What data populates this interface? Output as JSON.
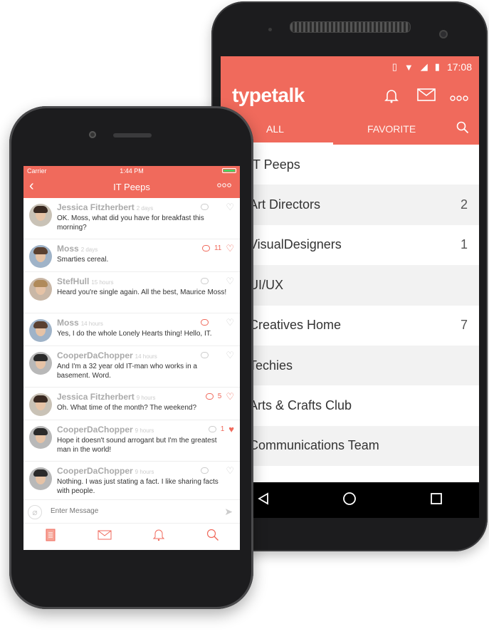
{
  "android": {
    "status_time": "17:08",
    "logo": "typetalk",
    "toolbar_icons": [
      "bell-icon",
      "mail-icon",
      "more-icon"
    ],
    "tabs": [
      {
        "label": "ALL"
      },
      {
        "label": "FAVORITE"
      }
    ],
    "topics": [
      {
        "name": "IT Peeps",
        "count": ""
      },
      {
        "name": "Art Directors",
        "count": "2"
      },
      {
        "name": "VisualDesigners",
        "count": "1"
      },
      {
        "name": "UI/UX",
        "count": ""
      },
      {
        "name": "Creatives Home",
        "count": "7"
      },
      {
        "name": "Techies",
        "count": ""
      },
      {
        "name": "Arts & Crafts Club",
        "count": ""
      },
      {
        "name": "Communications Team",
        "count": ""
      }
    ]
  },
  "ios": {
    "carrier": "Carrier",
    "time": "1:44 PM",
    "title": "IT Peeps",
    "input_placeholder": "Enter Message",
    "messages": [
      {
        "user": "Jessica Fitzherbert",
        "when": "2 days",
        "text": "OK. Moss, what did you have for breakfast this morning?",
        "replies": "",
        "likes": ""
      },
      {
        "user": "Moss",
        "when": "2 days",
        "text": "Smarties cereal.",
        "replies": "11",
        "likes": ""
      },
      {
        "user": "StefHull",
        "when": "15 hours",
        "text": "Heard you're single again. All the best, Maurice Moss!",
        "replies": "",
        "likes": ""
      },
      {
        "user": "Moss",
        "when": "14 hours",
        "text": "Yes, I do the whole Lonely Hearts thing! Hello, IT.",
        "replies": "",
        "likes": ""
      },
      {
        "user": "CooperDaChopper",
        "when": "14 hours",
        "text": "And I'm a 32 year old IT-man who works in a basement. Word.",
        "replies": "",
        "likes": ""
      },
      {
        "user": "Jessica Fitzherbert",
        "when": "9 hours",
        "text": "Oh. What time of the month? The weekend?",
        "replies": "",
        "likes": "5"
      },
      {
        "user": "CooperDaChopper",
        "when": "9 hours",
        "text": "Hope it doesn't sound arrogant but I'm the greatest man in the world!",
        "replies": "",
        "likes": "1"
      },
      {
        "user": "CooperDaChopper",
        "when": "9 hours",
        "text": "Nothing. I was just stating a fact. I like sharing facts with people.",
        "replies": "",
        "likes": ""
      }
    ],
    "tabbar": [
      "document-icon",
      "mail-icon",
      "bell-icon",
      "search-icon"
    ]
  },
  "colors": {
    "accent": "#f06a5c",
    "android_bar": "#000000"
  }
}
